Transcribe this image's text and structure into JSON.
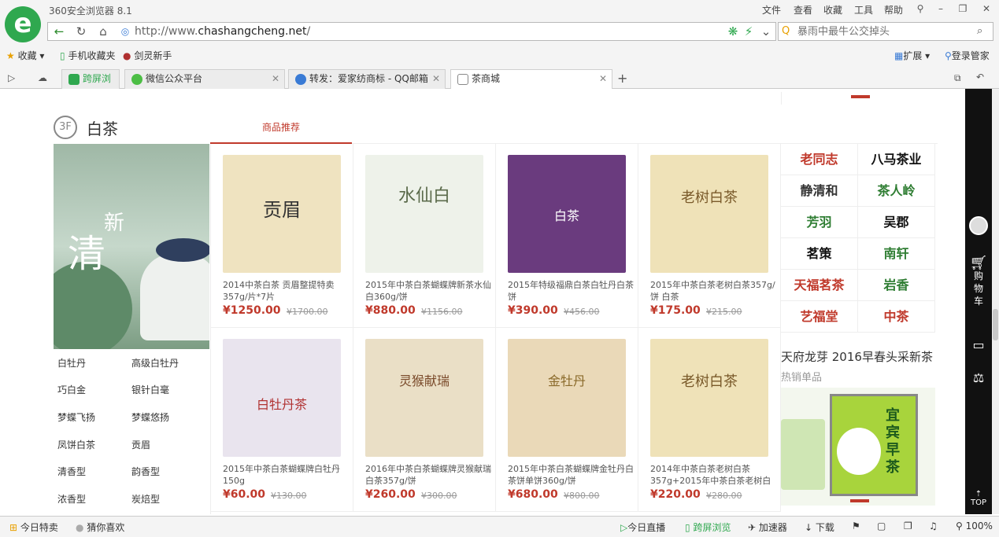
{
  "window": {
    "title": "360安全浏览器 8.1",
    "menu": [
      "文件",
      "查看",
      "收藏",
      "工具",
      "帮助"
    ]
  },
  "addressbar": {
    "url_prefix": "http://www.",
    "url_domain": "chashangcheng.net",
    "url_suffix": "/"
  },
  "search": {
    "placeholder": "暴雨中最牛公交掉头"
  },
  "bookmarks": {
    "favorites": "收藏",
    "mobile": "手机收藏夹",
    "jianling": "剑灵新手",
    "extensions": "扩展",
    "login": "登录管家"
  },
  "tabs": [
    {
      "label": "跨屏浏览"
    },
    {
      "label": "微信公众平台"
    },
    {
      "label": "转发：爱家纺商标 - QQ邮箱"
    },
    {
      "label": "茶商城"
    }
  ],
  "floor": {
    "badge": "3F",
    "name": "白茶",
    "tab": "商品推荐",
    "hero_text": "清",
    "hero_text2": "新"
  },
  "categories": [
    [
      "白牡丹",
      "高级白牡丹"
    ],
    [
      "巧白金",
      "银针白毫"
    ],
    [
      "梦蝶飞扬",
      "梦蝶悠扬"
    ],
    [
      "凤饼白茶",
      "贡眉"
    ],
    [
      "清香型",
      "韵香型"
    ],
    [
      "浓香型",
      "炭焙型"
    ]
  ],
  "products": [
    {
      "name": "2014中茶白茶 贡眉整提特卖357g/片*7片",
      "price": "¥1250.00",
      "orig": "¥1700.00",
      "img_text": "贡眉",
      "color": "#efe3c0"
    },
    {
      "name": "2015年中茶白茶蝴蝶牌新茶水仙白360g/饼",
      "price": "¥880.00",
      "orig": "¥1156.00",
      "img_text": "水仙白",
      "color": "#eef2ea"
    },
    {
      "name": "2015年特级福鼎白茶白牡丹白茶饼",
      "price": "¥390.00",
      "orig": "¥456.00",
      "img_text": "白茶",
      "color": "#6a3b7e"
    },
    {
      "name": "2015年中茶白茶老树白茶357g/饼 白茶",
      "price": "¥175.00",
      "orig": "¥215.00",
      "img_text": "老树白茶",
      "color": "#efe2b8"
    },
    {
      "name": "2015年中茶白茶蝴蝶牌白牡丹150g",
      "price": "¥60.00",
      "orig": "¥130.00",
      "img_text": "白牡丹茶",
      "color": "#e9e4ee"
    },
    {
      "name": "2016年中茶白茶蝴蝶牌灵猴献瑞白茶357g/饼",
      "price": "¥260.00",
      "orig": "¥300.00",
      "img_text": "灵猴献瑞",
      "color": "#eadfc6"
    },
    {
      "name": "2015年中茶白茶蝴蝶牌金牡丹白茶饼单饼360g/饼",
      "price": "¥680.00",
      "orig": "¥800.00",
      "img_text": "金牡丹",
      "color": "#ead9b8"
    },
    {
      "name": "2014年中茶白茶老树白茶357g+2015年中茶白茶老树白",
      "price": "¥220.00",
      "orig": "¥280.00",
      "img_text": "老树白茶",
      "color": "#efe2b8"
    }
  ],
  "brands": [
    "老同志",
    "八马茶业",
    "静清和",
    "茶人岭",
    "芳羽",
    "吴郡",
    "茗策",
    "南轩",
    "天福茗茶",
    "岩香",
    "艺福堂",
    "中茶"
  ],
  "promo": {
    "title": "天府龙芽  2016早春头采新茶",
    "sub": "热销单品",
    "img_text": "宜宾早茶"
  },
  "sidebar": {
    "cart": "购物车",
    "top": "TOP"
  },
  "statusbar": {
    "today_sale": "今日特卖",
    "guess": "猜你喜欢",
    "live": "今日直播",
    "cross": "跨屏浏览",
    "accel": "加速器",
    "download": "下载",
    "zoom": "100%"
  }
}
